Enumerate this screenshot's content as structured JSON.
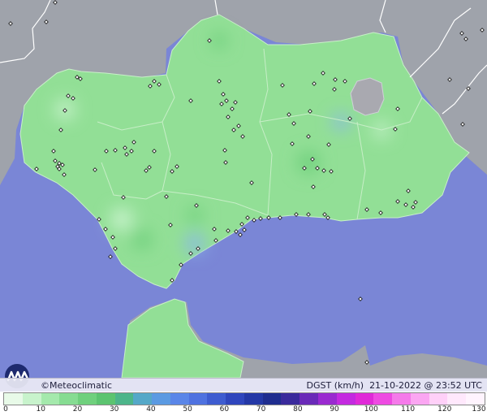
{
  "brand": {
    "name": "©Meteoclimatic"
  },
  "caption": {
    "variable": "DGST (km/h)",
    "datetime": "21-10-2022 @ 23:52 UTC"
  },
  "scale": {
    "ticks": [
      "0",
      "10",
      "20",
      "30",
      "40",
      "50",
      "60",
      "70",
      "80",
      "90",
      "100",
      "110",
      "120",
      "130"
    ],
    "colors": [
      "#e8fae8",
      "#c8f3cc",
      "#a4e9ac",
      "#86dc92",
      "#6fd07d",
      "#5cc470",
      "#4db58a",
      "#55a8c8",
      "#5b9ae2",
      "#5a86e8",
      "#4f72e0",
      "#3e5cd0",
      "#2f46bd",
      "#2438a6",
      "#1f2d8f",
      "#3a2a9c",
      "#6a2ab8",
      "#9a2ad0",
      "#c42ae0",
      "#e02ad8",
      "#ee4ae2",
      "#f57aea",
      "#fba6f2",
      "#ffd0f8",
      "#ffe8fc",
      "#fff4fe"
    ]
  },
  "stations": [
    [
      13,
      29
    ],
    [
      57,
      27
    ],
    [
      68,
      3
    ],
    [
      95,
      95
    ],
    [
      99,
      97
    ],
    [
      84,
      118
    ],
    [
      90,
      121
    ],
    [
      80,
      136
    ],
    [
      75,
      160
    ],
    [
      66,
      186
    ],
    [
      68,
      198
    ],
    [
      73,
      201
    ],
    [
      71,
      205
    ],
    [
      73,
      208
    ],
    [
      77,
      203
    ],
    [
      79,
      215
    ],
    [
      45,
      208
    ],
    [
      117,
      209
    ],
    [
      131,
      186
    ],
    [
      142,
      185
    ],
    [
      154,
      182
    ],
    [
      162,
      186
    ],
    [
      156,
      190
    ],
    [
      165,
      175
    ],
    [
      190,
      186
    ],
    [
      190,
      100
    ],
    [
      196,
      104
    ],
    [
      185,
      106
    ],
    [
      235,
      124
    ],
    [
      258,
      50
    ],
    [
      270,
      100
    ],
    [
      275,
      116
    ],
    [
      279,
      124
    ],
    [
      290,
      126
    ],
    [
      273,
      128
    ],
    [
      286,
      134
    ],
    [
      281,
      144
    ],
    [
      294,
      155
    ],
    [
      299,
      168
    ],
    [
      288,
      160
    ],
    [
      278,
      200
    ],
    [
      277,
      185
    ],
    [
      310,
      225
    ],
    [
      356,
      141
    ],
    [
      362,
      152
    ],
    [
      360,
      177
    ],
    [
      380,
      168
    ],
    [
      385,
      196
    ],
    [
      375,
      207
    ],
    [
      391,
      207
    ],
    [
      399,
      210
    ],
    [
      408,
      211
    ],
    [
      405,
      178
    ],
    [
      382,
      137
    ],
    [
      387,
      103
    ],
    [
      413,
      98
    ],
    [
      412,
      110
    ],
    [
      398,
      90
    ],
    [
      425,
      100
    ],
    [
      348,
      105
    ],
    [
      431,
      146
    ],
    [
      490,
      134
    ],
    [
      487,
      159
    ],
    [
      570,
      153
    ],
    [
      554,
      98
    ],
    [
      577,
      109
    ],
    [
      569,
      41
    ],
    [
      574,
      48
    ],
    [
      594,
      37
    ],
    [
      503,
      235
    ],
    [
      490,
      248
    ],
    [
      500,
      252
    ],
    [
      509,
      255
    ],
    [
      512,
      249
    ],
    [
      469,
      262
    ],
    [
      452,
      258
    ],
    [
      386,
      230
    ],
    [
      365,
      264
    ],
    [
      380,
      264
    ],
    [
      400,
      264
    ],
    [
      404,
      268
    ],
    [
      345,
      268
    ],
    [
      331,
      268
    ],
    [
      321,
      269
    ],
    [
      313,
      271
    ],
    [
      305,
      268
    ],
    [
      298,
      276
    ],
    [
      301,
      283
    ],
    [
      291,
      285
    ],
    [
      296,
      289
    ],
    [
      281,
      284
    ],
    [
      266,
      296
    ],
    [
      244,
      306
    ],
    [
      235,
      312
    ],
    [
      223,
      326
    ],
    [
      212,
      345
    ],
    [
      139,
      292
    ],
    [
      142,
      306
    ],
    [
      136,
      316
    ],
    [
      130,
      282
    ],
    [
      122,
      270
    ],
    [
      205,
      242
    ],
    [
      218,
      205
    ],
    [
      212,
      211
    ],
    [
      180,
      210
    ],
    [
      184,
      206
    ],
    [
      152,
      243
    ],
    [
      210,
      277
    ],
    [
      242,
      253
    ],
    [
      264,
      282
    ],
    [
      444,
      368
    ],
    [
      452,
      446
    ]
  ]
}
